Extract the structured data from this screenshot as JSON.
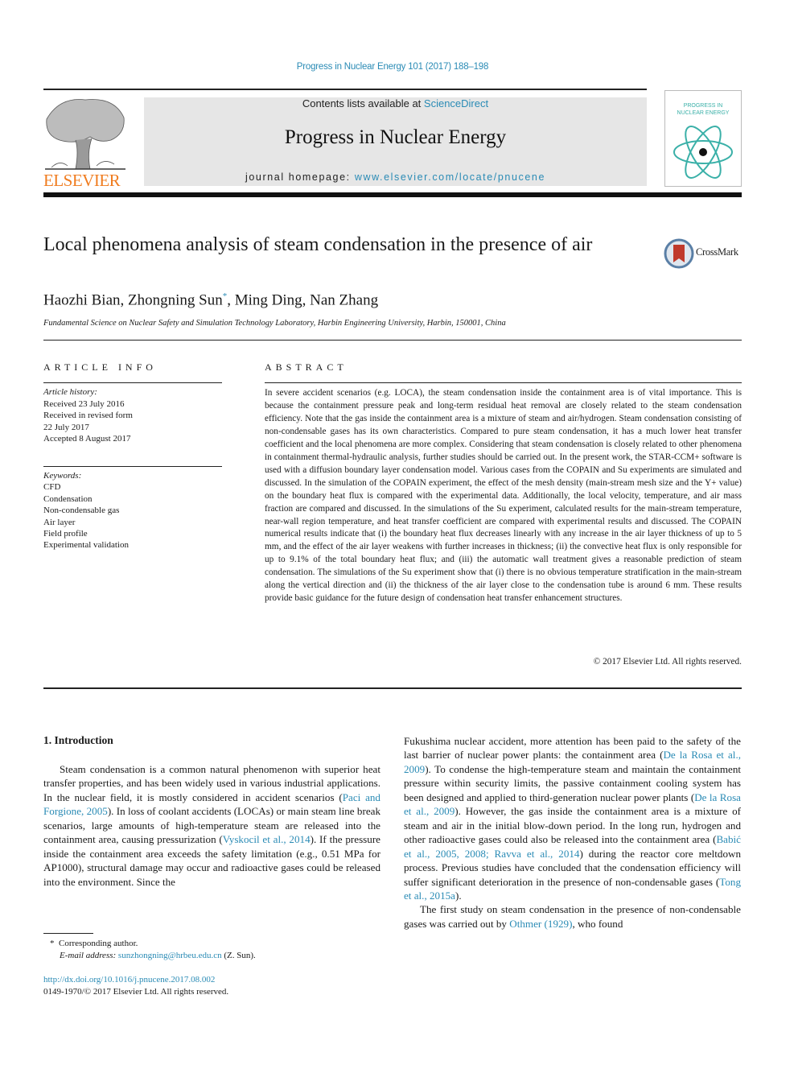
{
  "header": {
    "journal_ref": "Progress in Nuclear Energy 101 (2017) 188–198",
    "contents_prefix": "Contents lists available at ",
    "contents_link": "ScienceDirect",
    "journal_title": "Progress in Nuclear Energy",
    "homepage_prefix": "journal homepage: ",
    "homepage_link": "www.elsevier.com/locate/pnucene",
    "publisher_logo_text": "ELSEVIER",
    "cover_title_line1": "PROGRESS IN",
    "cover_title_line2": "NUCLEAR ENERGY",
    "colors": {
      "link": "#2a8bb5",
      "publisher": "#f07c1f",
      "banner": "#e6e6e6",
      "cover_accent": "#3ab0a8"
    }
  },
  "article": {
    "title": "Local phenomena analysis of steam condensation in the presence of air",
    "crossmark_label": "CrossMark",
    "authors": "Haozhi Bian, Zhongning Sun",
    "author_mark": "*",
    "authors_rest": ", Ming Ding, Nan Zhang",
    "affiliation": "Fundamental Science on Nuclear Safety and Simulation Technology Laboratory, Harbin Engineering University, Harbin, 150001, China"
  },
  "article_info": {
    "heading": "ARTICLE INFO",
    "history_label": "Article history:",
    "history": [
      "Received 23 July 2016",
      "Received in revised form",
      "22 July 2017",
      "Accepted 8 August 2017"
    ],
    "keywords_label": "Keywords:",
    "keywords": [
      "CFD",
      "Condensation",
      "Non-condensable gas",
      "Air layer",
      "Field profile",
      "Experimental validation"
    ]
  },
  "abstract": {
    "heading": "ABSTRACT",
    "text": "In severe accident scenarios (e.g. LOCA), the steam condensation inside the containment area is of vital importance. This is because the containment pressure peak and long-term residual heat removal are closely related to the steam condensation efficiency. Note that the gas inside the containment area is a mixture of steam and air/hydrogen. Steam condensation consisting of non-condensable gases has its own characteristics. Compared to pure steam condensation, it has a much lower heat transfer coefficient and the local phenomena are more complex. Considering that steam condensation is closely related to other phenomena in containment thermal-hydraulic analysis, further studies should be carried out. In the present work, the STAR-CCM+ software is used with a diffusion boundary layer condensation model. Various cases from the COPAIN and Su experiments are simulated and discussed. In the simulation of the COPAIN experiment, the effect of the mesh density (main-stream mesh size and the Y+ value) on the boundary heat flux is compared with the experimental data. Additionally, the local velocity, temperature, and air mass fraction are compared and discussed. In the simulations of the Su experiment, calculated results for the main-stream temperature, near-wall region temperature, and heat transfer coefficient are compared with experimental results and discussed. The COPAIN numerical results indicate that (i) the boundary heat flux decreases linearly with any increase in the air layer thickness of up to 5 mm, and the effect of the air layer weakens with further increases in thickness; (ii) the convective heat flux is only responsible for up to 9.1% of the total boundary heat flux; and (iii) the automatic wall treatment gives a reasonable prediction of steam condensation. The simulations of the Su experiment show that (i) there is no obvious temperature stratification in the main-stream along the vertical direction and (ii) the thickness of the air layer close to the condensation tube is around 6 mm. These results provide basic guidance for the future design of condensation heat transfer enhancement structures.",
    "copyright": "© 2017 Elsevier Ltd. All rights reserved."
  },
  "body": {
    "section_heading": "1.  Introduction",
    "left": [
      {
        "t": "Steam condensation is a common natural phenomenon with superior heat transfer properties, and has been widely used in various industrial applications. In the nuclear field, it is mostly considered in accident scenarios ("
      },
      {
        "l": "Paci and Forgione, 2005"
      },
      {
        "t": "). In loss of coolant accidents (LOCAs) or main steam line break scenarios, large amounts of high-temperature steam are released into the containment area, causing pressurization ("
      },
      {
        "l": "Vyskocil et al., 2014"
      },
      {
        "t": "). If the pressure inside the containment area exceeds the safety limitation (e.g., 0.51 MPa for AP1000), structural damage may occur and radioactive gases could be released into the environment. Since the"
      }
    ],
    "right_p1": [
      {
        "t": "Fukushima nuclear accident, more attention has been paid to the safety of the last barrier of nuclear power plants: the containment area ("
      },
      {
        "l": "De la Rosa et al., 2009"
      },
      {
        "t": "). To condense the high-temperature steam and maintain the containment pressure within security limits, the passive containment cooling system has been designed and applied to third-generation nuclear power plants ("
      },
      {
        "l": "De la Rosa et al., 2009"
      },
      {
        "t": "). However, the gas inside the containment area is a mixture of steam and air in the initial blow-down period. In the long run, hydrogen and other radioactive gases could also be released into the containment area ("
      },
      {
        "l": "Babić et al., 2005, 2008; Ravva et al., 2014"
      },
      {
        "t": ") during the reactor core meltdown process. Previous studies have concluded that the condensation efficiency will suffer significant deterioration in the presence of non-condensable gases ("
      },
      {
        "l": "Tong et al., 2015a"
      },
      {
        "t": ")."
      }
    ],
    "right_p2": [
      {
        "t": "The first study on steam condensation in the presence of non-condensable gases was carried out by "
      },
      {
        "l": "Othmer (1929)"
      },
      {
        "t": ", who found"
      }
    ]
  },
  "footnotes": {
    "corresponding_mark": "*",
    "corresponding": "Corresponding author.",
    "email_label": "E-mail address:",
    "email": "sunzhongning@hrbeu.edu.cn",
    "email_suffix": "(Z. Sun).",
    "doi": "http://dx.doi.org/10.1016/j.pnucene.2017.08.002",
    "issn_copyright": "0149-1970/© 2017 Elsevier Ltd. All rights reserved."
  }
}
